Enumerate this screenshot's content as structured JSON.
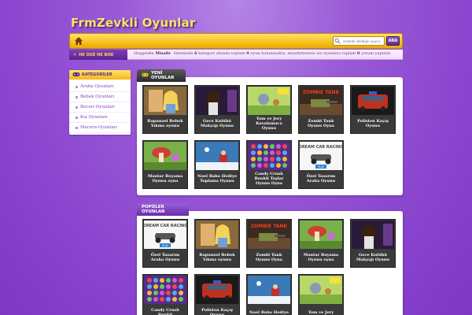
{
  "site": {
    "logo": "FrmZevkli Oyunlar"
  },
  "navbar": {
    "search_placeholder": "aramak istedigin oyunu",
    "search_button": "ARA"
  },
  "welcome": {
    "tag": "HE OGE HE NOE",
    "text": {
      "hello": "Hoşgeldin",
      "user": "Misafir",
      "part1": ". Sitemizde",
      "categories": "6",
      "part2": "kategori altında toplam",
      "games": "9",
      "part3": "oyun bulunmakta, misafirlerimiz ise oyunlara toplam",
      "comments": "0",
      "part4": "yorum yaptılar."
    }
  },
  "categories": {
    "title": "KATEGORİLER",
    "items": [
      "Araba Oyunları",
      "Bebek Oyunları",
      "Beceri Oyunları",
      "Kız Oyunları",
      "Macera Oyunları"
    ]
  },
  "new_games": {
    "title": "YENİ OYUNLAR",
    "items": [
      {
        "title": "Rapunzel Bebek Yıkma oyunu",
        "thumb": "rapunzel"
      },
      {
        "title": "Gece Kulübü Makyajı Oyunu",
        "thumb": "club"
      },
      {
        "title": "Tom ve Jery Kovalamaca Oyunu",
        "thumb": "tom"
      },
      {
        "title": "Zombi Tank Oyunu Oyna",
        "thumb": "zombie"
      },
      {
        "title": "Polisten Kaçış Oyunu",
        "thumb": "police"
      },
      {
        "title": "Mantar Boyama Oyunu oyna",
        "thumb": "mushroom"
      },
      {
        "title": "Noel Baba Hediye Toplama Oyunu",
        "thumb": "santa"
      },
      {
        "title": "Candy Crush Renkli Taşlar Oyunu Oyna",
        "thumb": "candy"
      },
      {
        "title": "Özel Tasarım Araba Oyunu",
        "thumb": "car"
      }
    ]
  },
  "popular_games": {
    "title": "POPÜLER OYUNLAR",
    "items": [
      {
        "title": "Özel Tasarım Araba Oyunu",
        "thumb": "car"
      },
      {
        "title": "Rapunzel Bebek Yıkma oyunu",
        "thumb": "rapunzel"
      },
      {
        "title": "Zombi Tank Oyunu Oyna",
        "thumb": "zombie"
      },
      {
        "title": "Mantar Boyama Oyunu oyna",
        "thumb": "mushroom"
      },
      {
        "title": "Gece Kulübü Makyajı Oyunu",
        "thumb": "club"
      },
      {
        "title": "Candy Crush Renkli",
        "thumb": "candy"
      },
      {
        "title": "Polisten Kaçış Oyunu",
        "thumb": "police"
      },
      {
        "title": "Noel Baba Hediye",
        "thumb": "santa"
      },
      {
        "title": "Tom ve Jery",
        "thumb": "tom"
      }
    ]
  },
  "thumb_texts": {
    "zombie": "ZOMBIE TANK",
    "car": "DREAM CAR RACING",
    "car_play": "PLAY"
  }
}
